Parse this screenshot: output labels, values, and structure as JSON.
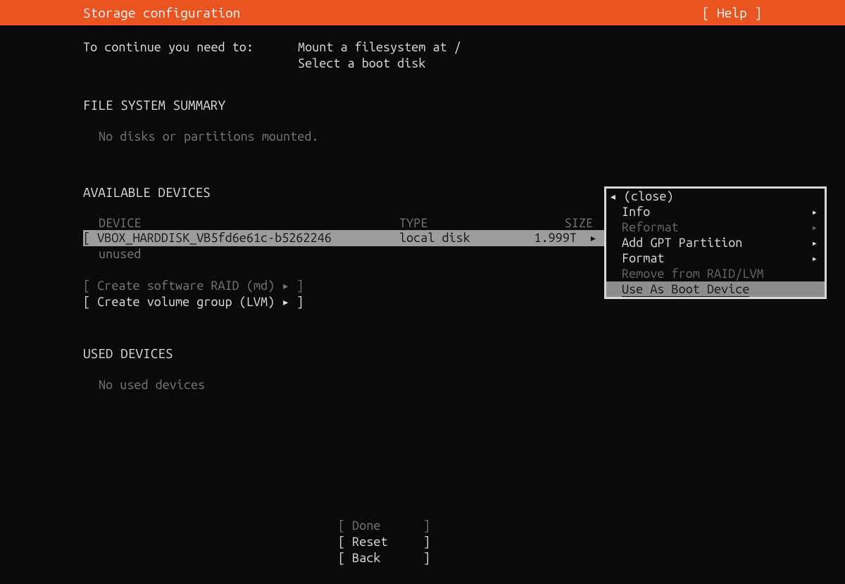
{
  "header": {
    "title": "Storage configuration",
    "help": "[ Help ]"
  },
  "continue": {
    "label": "To continue you need to: ",
    "lines": [
      "Mount a filesystem at /",
      "Select a boot disk"
    ]
  },
  "fs_summary": {
    "title": "FILE SYSTEM SUMMARY",
    "empty": "No disks or partitions mounted."
  },
  "available": {
    "title": "AVAILABLE DEVICES",
    "columns": {
      "device": "DEVICE",
      "type": "TYPE",
      "size": "SIZE"
    },
    "devices": [
      {
        "name": "VBOX_HARDDISK_VB5fd6e61c-b5262246",
        "type": "local disk",
        "size": "1.999T",
        "state": "unused"
      }
    ],
    "raid_line": "[ Create software RAID (md) ▸ ]",
    "lvm_line": "[ Create volume group (LVM) ▸ ]"
  },
  "context_menu": {
    "items": [
      {
        "label": "◂ (close)",
        "arrow": "",
        "enabled": true,
        "selected": false,
        "close": true
      },
      {
        "label": "Info",
        "arrow": "▸",
        "enabled": true,
        "selected": false
      },
      {
        "label": "Reformat",
        "arrow": "▸",
        "enabled": false,
        "selected": false
      },
      {
        "label": "Add GPT Partition",
        "arrow": "▸",
        "enabled": true,
        "selected": false
      },
      {
        "label": "Format",
        "arrow": "▸",
        "enabled": true,
        "selected": false
      },
      {
        "label": "Remove from RAID/LVM",
        "arrow": "",
        "enabled": false,
        "selected": false
      },
      {
        "label": "Use As Boot Device",
        "arrow": "",
        "enabled": true,
        "selected": true
      }
    ]
  },
  "used": {
    "title": "USED DEVICES",
    "empty": "No used devices"
  },
  "buttons": {
    "done": "Done",
    "reset": "Reset",
    "back": "Back"
  }
}
